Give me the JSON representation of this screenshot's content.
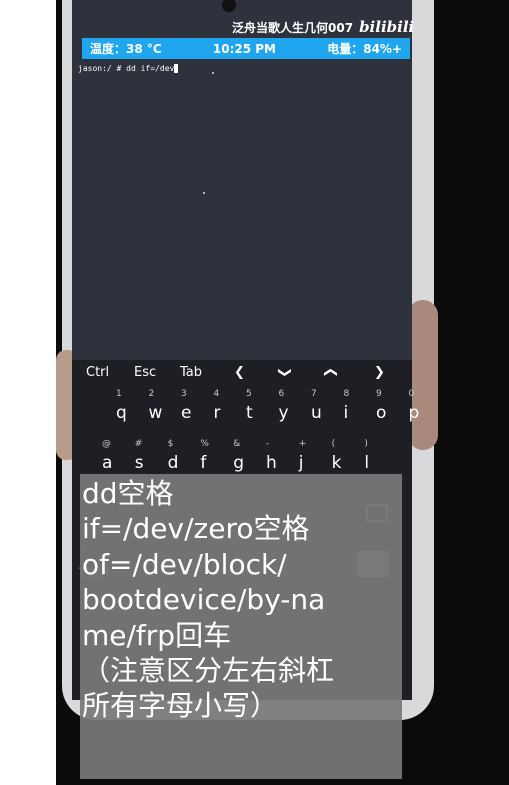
{
  "watermark": {
    "channel": "泛舟当歌人生几何007",
    "logo": "bilibili"
  },
  "status_bar": {
    "temperature": "温度：38 °C",
    "time": "10:25 PM",
    "battery": "电量：84%+"
  },
  "terminal": {
    "command_line": "jason:/ # dd if=/dev"
  },
  "keyboard": {
    "extra_keys": [
      "Ctrl",
      "Esc",
      "Tab",
      "❮",
      "❯",
      "❮",
      "❯"
    ],
    "row1": [
      {
        "k": "q",
        "s": "1"
      },
      {
        "k": "w",
        "s": "2"
      },
      {
        "k": "e",
        "s": "3"
      },
      {
        "k": "r",
        "s": "4"
      },
      {
        "k": "t",
        "s": "5"
      },
      {
        "k": "y",
        "s": "6"
      },
      {
        "k": "u",
        "s": "7"
      },
      {
        "k": "i",
        "s": "8"
      },
      {
        "k": "o",
        "s": "9"
      },
      {
        "k": "p",
        "s": "0"
      }
    ],
    "row2": [
      {
        "k": "a",
        "s": "@"
      },
      {
        "k": "s",
        "s": "#"
      },
      {
        "k": "d",
        "s": "$"
      },
      {
        "k": "f",
        "s": "%"
      },
      {
        "k": "g",
        "s": "&"
      },
      {
        "k": "h",
        "s": "-"
      },
      {
        "k": "j",
        "s": "+"
      },
      {
        "k": "k",
        "s": "("
      },
      {
        "k": "l",
        "s": ")"
      }
    ]
  },
  "caption": {
    "lines": [
      "dd空格",
      "if=/dev/zero空格",
      "of=/dev/block/",
      "bootdevice/by-na",
      "me/frp回车",
      "（注意区分左右斜杠",
      "所有字母小写）"
    ]
  }
}
